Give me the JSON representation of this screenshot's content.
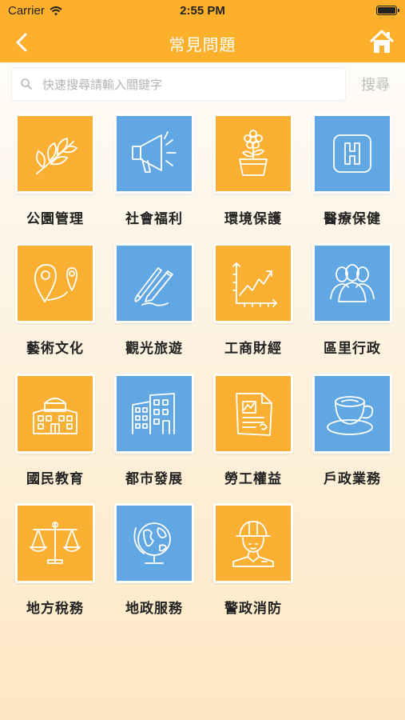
{
  "status": {
    "carrier": "Carrier",
    "time": "2:55 PM"
  },
  "nav": {
    "title": "常見問題"
  },
  "search": {
    "placeholder": "快速搜尋請輸入關鍵字",
    "value": "",
    "button_label": "搜尋"
  },
  "colors": {
    "accent": "#fcb02b",
    "tile_orange": "#fbb033",
    "tile_blue": "#60a7e4"
  },
  "categories": [
    {
      "label": "公園管理",
      "icon": "leaves-icon",
      "color": "orange"
    },
    {
      "label": "社會福利",
      "icon": "megaphone-icon",
      "color": "blue"
    },
    {
      "label": "環境保護",
      "icon": "flower-pot-icon",
      "color": "orange"
    },
    {
      "label": "醫療保健",
      "icon": "hospital-icon",
      "color": "blue"
    },
    {
      "label": "藝術文化",
      "icon": "map-pin-icon",
      "color": "orange"
    },
    {
      "label": "觀光旅遊",
      "icon": "brush-pen-icon",
      "color": "blue"
    },
    {
      "label": "工商財經",
      "icon": "growth-chart-icon",
      "color": "orange"
    },
    {
      "label": "區里行政",
      "icon": "people-icon",
      "color": "blue"
    },
    {
      "label": "國民教育",
      "icon": "school-icon",
      "color": "orange"
    },
    {
      "label": "都市發展",
      "icon": "buildings-icon",
      "color": "blue"
    },
    {
      "label": "勞工權益",
      "icon": "document-icon",
      "color": "orange"
    },
    {
      "label": "戶政業務",
      "icon": "coffee-cup-icon",
      "color": "blue"
    },
    {
      "label": "地方稅務",
      "icon": "scales-icon",
      "color": "orange"
    },
    {
      "label": "地政服務",
      "icon": "globe-icon",
      "color": "blue"
    },
    {
      "label": "警政消防",
      "icon": "helmet-worker-icon",
      "color": "orange"
    }
  ]
}
